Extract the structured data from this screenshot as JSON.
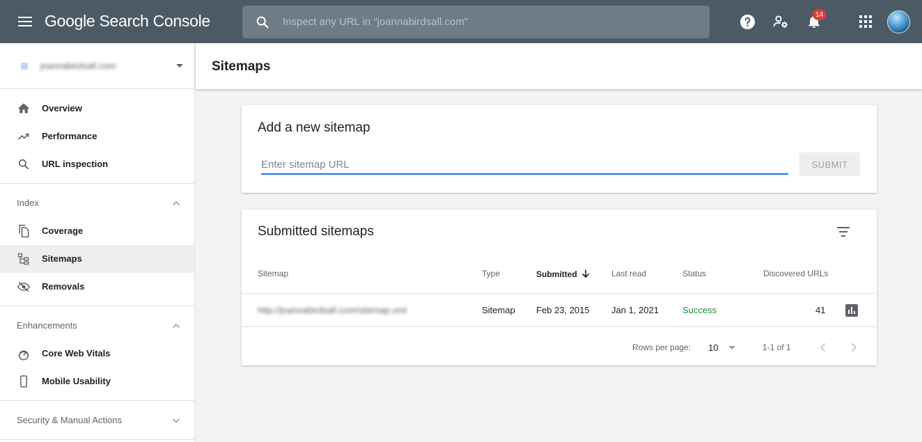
{
  "app": {
    "title": "Google Search Console",
    "search_placeholder": "Inspect any URL in \"joannabirdsall.com\"",
    "notifications_count": "14"
  },
  "sidebar": {
    "property_name": "joannabirdsall.com",
    "items_top": [
      {
        "label": "Overview",
        "icon": "home-icon"
      },
      {
        "label": "Performance",
        "icon": "trending-up-icon"
      },
      {
        "label": "URL inspection",
        "icon": "search-icon"
      }
    ],
    "sections": [
      {
        "label": "Index",
        "items": [
          {
            "label": "Coverage",
            "icon": "copy-icon"
          },
          {
            "label": "Sitemaps",
            "icon": "sitemap-icon",
            "active": true
          },
          {
            "label": "Removals",
            "icon": "eye-off-icon"
          }
        ]
      },
      {
        "label": "Enhancements",
        "items": [
          {
            "label": "Core Web Vitals",
            "icon": "speedometer-icon"
          },
          {
            "label": "Mobile Usability",
            "icon": "phone-icon"
          }
        ]
      },
      {
        "label": "Security & Manual Actions",
        "items": []
      }
    ]
  },
  "page": {
    "title": "Sitemaps"
  },
  "add_sitemap": {
    "title": "Add a new sitemap",
    "placeholder": "Enter sitemap URL",
    "submit_label": "SUBMIT"
  },
  "submitted": {
    "title": "Submitted sitemaps",
    "columns": {
      "sitemap": "Sitemap",
      "type": "Type",
      "submitted": "Submitted",
      "last_read": "Last read",
      "status": "Status",
      "discovered": "Discovered URLs"
    },
    "rows": [
      {
        "sitemap": "http://joannabirdsall.com/sitemap.xml",
        "type": "Sitemap",
        "submitted": "Feb 23, 2015",
        "last_read": "Jan 1, 2021",
        "status": "Success",
        "discovered": "41"
      }
    ],
    "footer": {
      "rows_per_page_label": "Rows per page:",
      "rows_per_page_value": "10",
      "range": "1-1 of 1"
    }
  },
  "colors": {
    "topbar": "#4b5a65",
    "accent": "#1a73e8",
    "success": "#1e8e3e"
  }
}
